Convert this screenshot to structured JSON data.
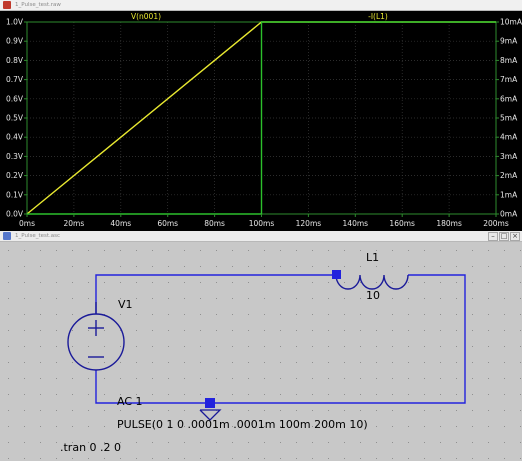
{
  "plot_window": {
    "title": "1_Pulse_test.raw",
    "trace_left_label": "V(n001)",
    "trace_right_label": "-I(L1)",
    "colors": {
      "background": "#000000",
      "grid": "#3a3a3a",
      "axis": "#2e8b2e",
      "left_trace": "#e8e830",
      "right_trace": "#2cc02c",
      "label_text": "#e6e6e6"
    }
  },
  "chart_data": {
    "type": "line",
    "title": "",
    "x": {
      "label": "",
      "ticks": [
        "0ms",
        "20ms",
        "40ms",
        "60ms",
        "80ms",
        "100ms",
        "120ms",
        "140ms",
        "160ms",
        "180ms",
        "200ms"
      ],
      "range": [
        0,
        200
      ]
    },
    "y_left": {
      "label": "",
      "ticks": [
        "0.0V",
        "0.1V",
        "0.2V",
        "0.3V",
        "0.4V",
        "0.5V",
        "0.6V",
        "0.7V",
        "0.8V",
        "0.9V",
        "1.0V"
      ],
      "range": [
        0,
        1.0
      ]
    },
    "y_right": {
      "label": "",
      "ticks": [
        "0mA",
        "1mA",
        "2mA",
        "3mA",
        "4mA",
        "5mA",
        "6mA",
        "7mA",
        "8mA",
        "9mA",
        "10mA"
      ],
      "range": [
        0,
        10
      ]
    },
    "series": [
      {
        "name": "V(n001)",
        "axis": "left",
        "color": "#e8e830",
        "x": [
          0,
          100,
          200
        ],
        "y": [
          0,
          1.0,
          1.0
        ]
      },
      {
        "name": "-I(L1)",
        "axis": "right",
        "color": "#2cc02c",
        "x": [
          0,
          100,
          100,
          200
        ],
        "y": [
          0,
          0,
          10,
          10
        ]
      }
    ],
    "grid": true
  },
  "schematic_window": {
    "title": "1_Pulse_test.asc",
    "components": {
      "source_name": "V1",
      "inductor_name": "L1",
      "inductor_value": "10",
      "ac_label": "AC 1",
      "pulse_label": "PULSE(0 1 0 .0001m .0001m 100m 200m 10)"
    },
    "directive": ".tran 0 .2 0",
    "colors": {
      "background": "#c8c8c8",
      "wire": "#2222dd",
      "component": "#1a1a99",
      "text": "#000000",
      "dots": "#909090"
    }
  }
}
